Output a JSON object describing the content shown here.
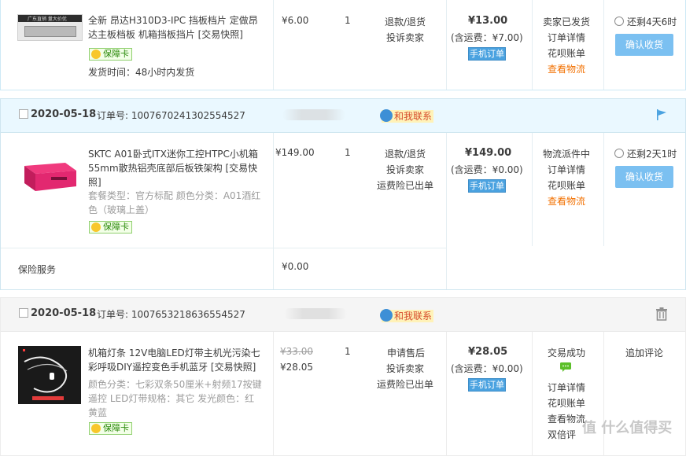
{
  "orders": [
    {
      "product": {
        "title": "全新 昂达H310D3-IPC 挡板档片 定做昂达主板档板 机箱挡板挡片 [交易快照]",
        "guarantee": "保障卡",
        "ship_time": "发货时间：48小时内发货",
        "thumb_text": "广东直销 量大价优"
      },
      "unit_price": "¥6.00",
      "qty": "1",
      "after_sale": [
        "退款/退货",
        "投诉卖家"
      ],
      "total": "¥13.00",
      "shipping": "(含运费：¥7.00)",
      "mobile_label": "手机订单",
      "status": [
        "卖家已发货",
        "订单详情",
        "花呗账单"
      ],
      "status_link": "查看物流",
      "remaining": "还剩4天6时",
      "confirm": "确认收货"
    },
    {
      "date": "2020-05-18",
      "order_no": "订单号: 1007670241302554527",
      "contact": "和我联系",
      "product": {
        "title": "SKTC A01卧式ITX迷你工控HTPC小机箱55mm散热铝壳底部后板铁架构 [交易快照]",
        "attrs": "套餐类型：官方标配  颜色分类：A01酒红色（玻璃上盖）",
        "guarantee": "保障卡"
      },
      "unit_price": "¥149.00",
      "qty": "1",
      "after_sale": [
        "退款/退货",
        "投诉卖家",
        "运费险已出单"
      ],
      "total": "¥149.00",
      "shipping": "(含运费：¥0.00)",
      "mobile_label": "手机订单",
      "status": [
        "物流派件中",
        "订单详情",
        "花呗账单"
      ],
      "status_link": "查看物流",
      "remaining": "还剩2天1时",
      "confirm": "确认收货",
      "insurance_label": "保险服务",
      "insurance_price": "¥0.00"
    },
    {
      "date": "2020-05-18",
      "order_no": "订单号: 1007653218636554527",
      "contact": "和我联系",
      "product": {
        "title": "机箱灯条 12V电脑LED灯带主机光污染七彩呼吸DIY遥控变色手机蓝牙 [交易快照]",
        "attrs": "颜色分类：七彩双条50厘米+射频17按键遥控  LED灯带规格：其它  发光颜色：红黄蓝",
        "guarantee": "保障卡"
      },
      "original_price": "¥33.00",
      "unit_price": "¥28.05",
      "qty": "1",
      "after_sale": [
        "申请售后",
        "投诉卖家",
        "运费险已出单"
      ],
      "total": "¥28.05",
      "shipping": "(含运费：¥0.00)",
      "mobile_label": "手机订单",
      "status": [
        "交易成功",
        "订单详情",
        "花呗账单",
        "查看物流",
        "双倍评"
      ],
      "action": "追加评论"
    }
  ],
  "watermark": "值 什么值得买",
  "icons": [
    "flag-icon",
    "trash-icon",
    "clock-icon",
    "chat-icon",
    "contact-icon"
  ],
  "colors": {
    "accent": "#4aa2e0",
    "orange": "#f27000",
    "header_blue": "#eaf8ff"
  }
}
